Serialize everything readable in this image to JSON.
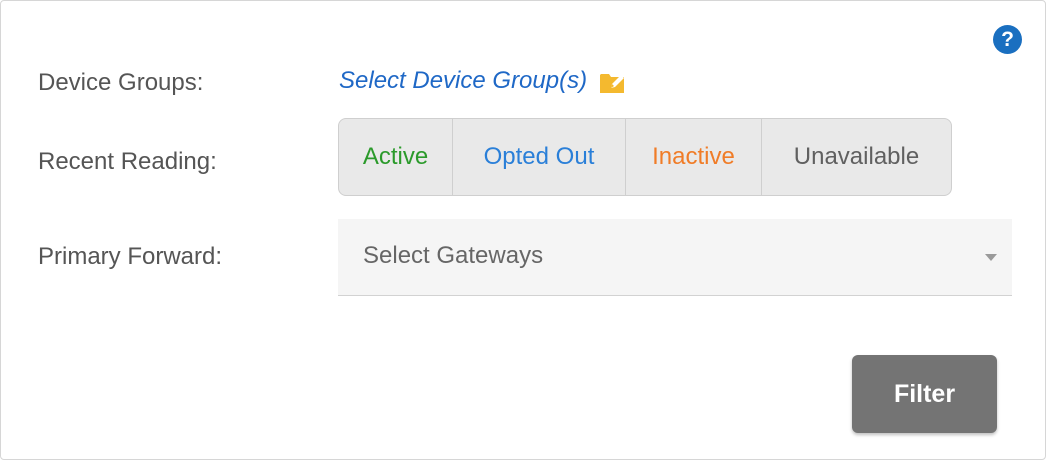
{
  "help": {
    "icon": "question-circle-icon",
    "glyph": "?"
  },
  "fields": {
    "device_groups_label": "Device Groups:",
    "recent_reading_label": "Recent Reading:",
    "primary_forward_label": "Primary Forward:"
  },
  "device_groups": {
    "link_text": "Select Device Group(s)",
    "icon": "folder-edit-icon"
  },
  "recent_reading": {
    "options": [
      {
        "label": "Active",
        "color": "#2b9a2b"
      },
      {
        "label": "Opted Out",
        "color": "#2a7fd8"
      },
      {
        "label": "Inactive",
        "color": "#f07c27"
      },
      {
        "label": "Unavailable",
        "color": "#606060"
      }
    ]
  },
  "primary_forward": {
    "placeholder": "Select Gateways",
    "icon": "caret-down-icon"
  },
  "actions": {
    "filter_label": "Filter"
  }
}
